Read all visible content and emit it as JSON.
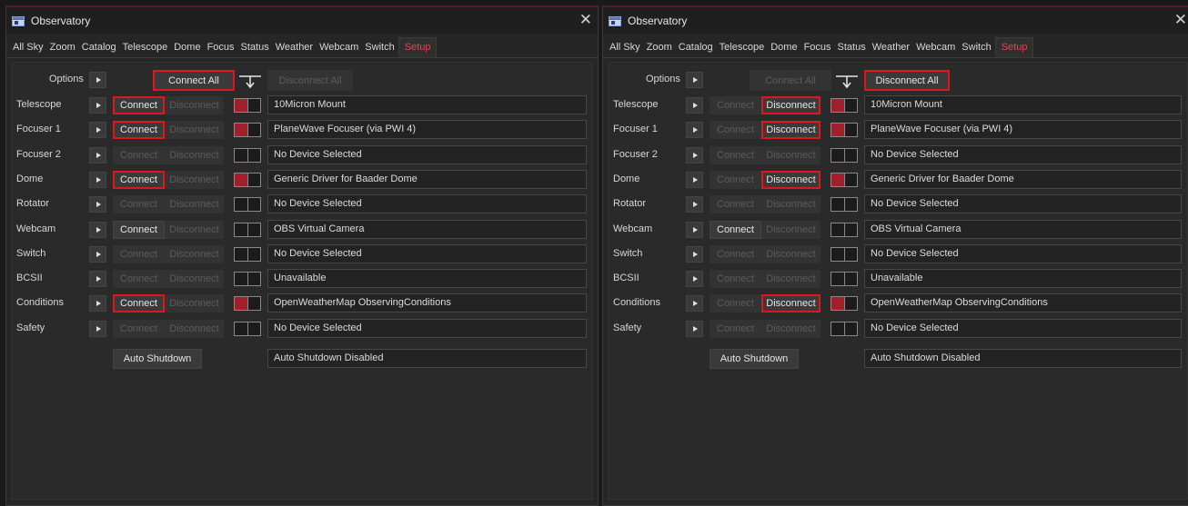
{
  "windows": [
    {
      "title": "Observatory",
      "tabs": [
        "All Sky",
        "Zoom",
        "Catalog",
        "Telescope",
        "Dome",
        "Focus",
        "Status",
        "Weather",
        "Webcam",
        "Switch",
        "Setup"
      ],
      "active_tab": "Setup",
      "options_label": "Options",
      "connect_all_label": "Connect All",
      "connect_all_enabled": true,
      "connect_all_highlighted": true,
      "disconnect_all_label": "Disconnect All",
      "disconnect_all_enabled": false,
      "disconnect_all_highlighted": false,
      "devices": [
        {
          "label": "Telescope",
          "connect": "Connect",
          "disconnect": "Disconnect",
          "connect_enabled": true,
          "disconnect_enabled": false,
          "highlight": "connect",
          "connected": true,
          "name": "10Micron Mount"
        },
        {
          "label": "Focuser 1",
          "connect": "Connect",
          "disconnect": "Disconnect",
          "connect_enabled": true,
          "disconnect_enabled": false,
          "highlight": "connect",
          "connected": true,
          "name": "PlaneWave Focuser (via PWI 4)"
        },
        {
          "label": "Focuser 2",
          "connect": "Connect",
          "disconnect": "Disconnect",
          "connect_enabled": false,
          "disconnect_enabled": false,
          "highlight": "",
          "connected": false,
          "name": "No Device Selected"
        },
        {
          "label": "Dome",
          "connect": "Connect",
          "disconnect": "Disconnect",
          "connect_enabled": true,
          "disconnect_enabled": false,
          "highlight": "connect",
          "connected": true,
          "name": "Generic Driver for Baader Dome"
        },
        {
          "label": "Rotator",
          "connect": "Connect",
          "disconnect": "Disconnect",
          "connect_enabled": false,
          "disconnect_enabled": false,
          "highlight": "",
          "connected": false,
          "name": "No Device Selected"
        },
        {
          "label": "Webcam",
          "connect": "Connect",
          "disconnect": "Disconnect",
          "connect_enabled": true,
          "disconnect_enabled": false,
          "highlight": "",
          "connected": false,
          "name": "OBS Virtual Camera"
        },
        {
          "label": "Switch",
          "connect": "Connect",
          "disconnect": "Disconnect",
          "connect_enabled": false,
          "disconnect_enabled": false,
          "highlight": "",
          "connected": false,
          "name": "No Device Selected"
        },
        {
          "label": "BCSII",
          "connect": "Connect",
          "disconnect": "Disconnect",
          "connect_enabled": false,
          "disconnect_enabled": false,
          "highlight": "",
          "connected": false,
          "name": "Unavailable"
        },
        {
          "label": "Conditions",
          "connect": "Connect",
          "disconnect": "Disconnect",
          "connect_enabled": true,
          "disconnect_enabled": false,
          "highlight": "connect",
          "connected": true,
          "name": "OpenWeatherMap ObservingConditions"
        },
        {
          "label": "Safety",
          "connect": "Connect",
          "disconnect": "Disconnect",
          "connect_enabled": false,
          "disconnect_enabled": false,
          "highlight": "",
          "connected": false,
          "name": "No Device Selected"
        }
      ],
      "auto_shutdown_label": "Auto Shutdown",
      "auto_shutdown_status": "Auto Shutdown Disabled"
    },
    {
      "title": "Observatory",
      "tabs": [
        "All Sky",
        "Zoom",
        "Catalog",
        "Telescope",
        "Dome",
        "Focus",
        "Status",
        "Weather",
        "Webcam",
        "Switch",
        "Setup"
      ],
      "active_tab": "Setup",
      "options_label": "Options",
      "connect_all_label": "Connect All",
      "connect_all_enabled": false,
      "connect_all_highlighted": false,
      "disconnect_all_label": "Disconnect All",
      "disconnect_all_enabled": true,
      "disconnect_all_highlighted": true,
      "devices": [
        {
          "label": "Telescope",
          "connect": "Connect",
          "disconnect": "Disconnect",
          "connect_enabled": false,
          "disconnect_enabled": true,
          "highlight": "disconnect",
          "connected": true,
          "name": "10Micron Mount"
        },
        {
          "label": "Focuser 1",
          "connect": "Connect",
          "disconnect": "Disconnect",
          "connect_enabled": false,
          "disconnect_enabled": true,
          "highlight": "disconnect",
          "connected": true,
          "name": "PlaneWave Focuser (via PWI 4)"
        },
        {
          "label": "Focuser 2",
          "connect": "Connect",
          "disconnect": "Disconnect",
          "connect_enabled": false,
          "disconnect_enabled": false,
          "highlight": "",
          "connected": false,
          "name": "No Device Selected"
        },
        {
          "label": "Dome",
          "connect": "Connect",
          "disconnect": "Disconnect",
          "connect_enabled": false,
          "disconnect_enabled": true,
          "highlight": "disconnect",
          "connected": true,
          "name": "Generic Driver for Baader Dome"
        },
        {
          "label": "Rotator",
          "connect": "Connect",
          "disconnect": "Disconnect",
          "connect_enabled": false,
          "disconnect_enabled": false,
          "highlight": "",
          "connected": false,
          "name": "No Device Selected"
        },
        {
          "label": "Webcam",
          "connect": "Connect",
          "disconnect": "Disconnect",
          "connect_enabled": true,
          "disconnect_enabled": false,
          "highlight": "",
          "connected": false,
          "name": "OBS Virtual Camera"
        },
        {
          "label": "Switch",
          "connect": "Connect",
          "disconnect": "Disconnect",
          "connect_enabled": false,
          "disconnect_enabled": false,
          "highlight": "",
          "connected": false,
          "name": "No Device Selected"
        },
        {
          "label": "BCSII",
          "connect": "Connect",
          "disconnect": "Disconnect",
          "connect_enabled": false,
          "disconnect_enabled": false,
          "highlight": "",
          "connected": false,
          "name": "Unavailable"
        },
        {
          "label": "Conditions",
          "connect": "Connect",
          "disconnect": "Disconnect",
          "connect_enabled": false,
          "disconnect_enabled": true,
          "highlight": "disconnect",
          "connected": true,
          "name": "OpenWeatherMap ObservingConditions"
        },
        {
          "label": "Safety",
          "connect": "Connect",
          "disconnect": "Disconnect",
          "connect_enabled": false,
          "disconnect_enabled": false,
          "highlight": "",
          "connected": false,
          "name": "No Device Selected"
        }
      ],
      "auto_shutdown_label": "Auto Shutdown",
      "auto_shutdown_status": "Auto Shutdown Disabled"
    }
  ],
  "colors": {
    "highlight_border": "#e0161d",
    "connected_indicator": "#a0202c",
    "active_tab_text": "#d84a55"
  },
  "icons": {
    "app": "observatory-window-icon",
    "close": "close-icon",
    "expand": "chevron-right-icon",
    "indicator": "connection-status-icon"
  }
}
